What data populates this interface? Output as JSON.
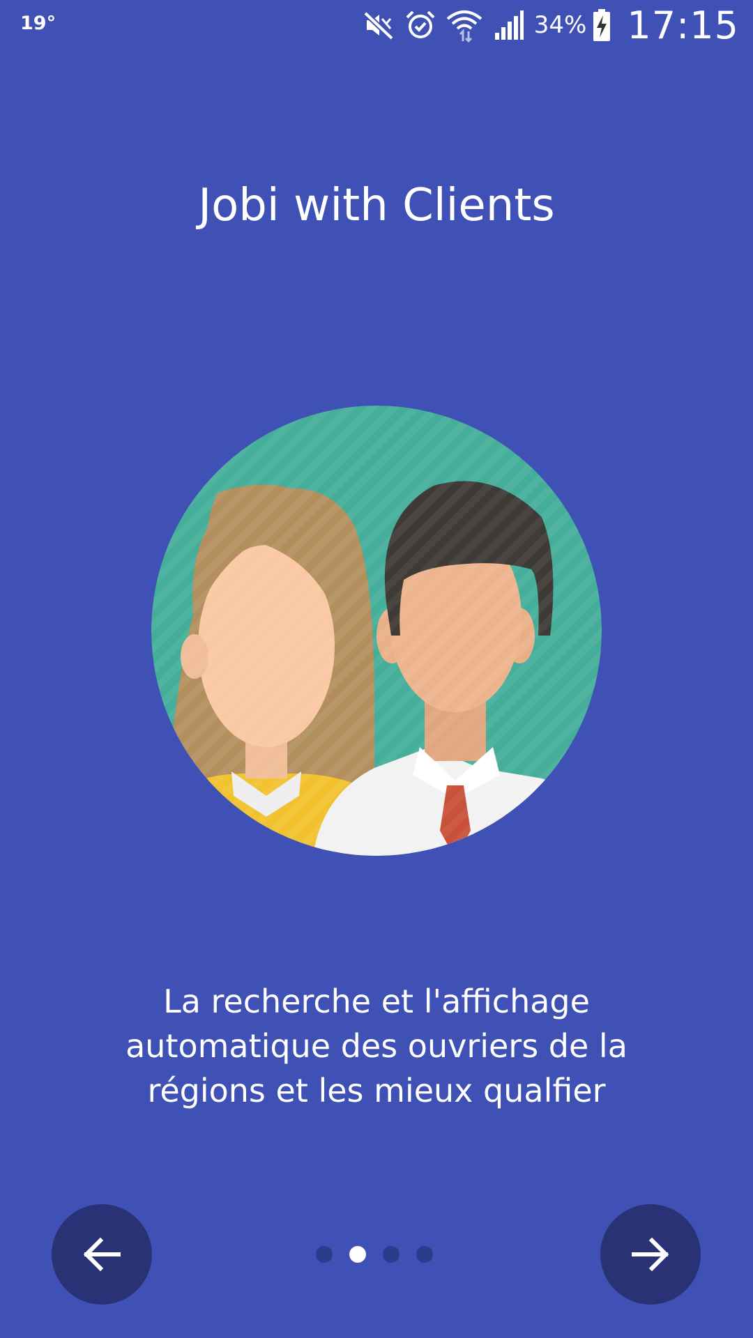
{
  "status_bar": {
    "temperature": "19°",
    "battery_percent": "34%",
    "time": "17:15",
    "icons": [
      "mute-icon",
      "alarm-icon",
      "wifi-icon",
      "signal-icon",
      "battery-charging-icon"
    ]
  },
  "onboarding": {
    "title": "Jobi with Clients",
    "description_lines": [
      "La recherche et l'affichage",
      "automatique des ouvriers de la",
      "régions et les mieux qualfier"
    ],
    "page_count": 4,
    "current_page": 2
  },
  "navigation": {
    "prev_icon": "arrow-left-icon",
    "next_icon": "arrow-right-icon"
  },
  "colors": {
    "background": "#3f51b5",
    "nav_button": "#283275",
    "dot_inactive": "#2c3a8a",
    "dot_active": "#ffffff",
    "illustration_circle": "#45ae9a"
  }
}
